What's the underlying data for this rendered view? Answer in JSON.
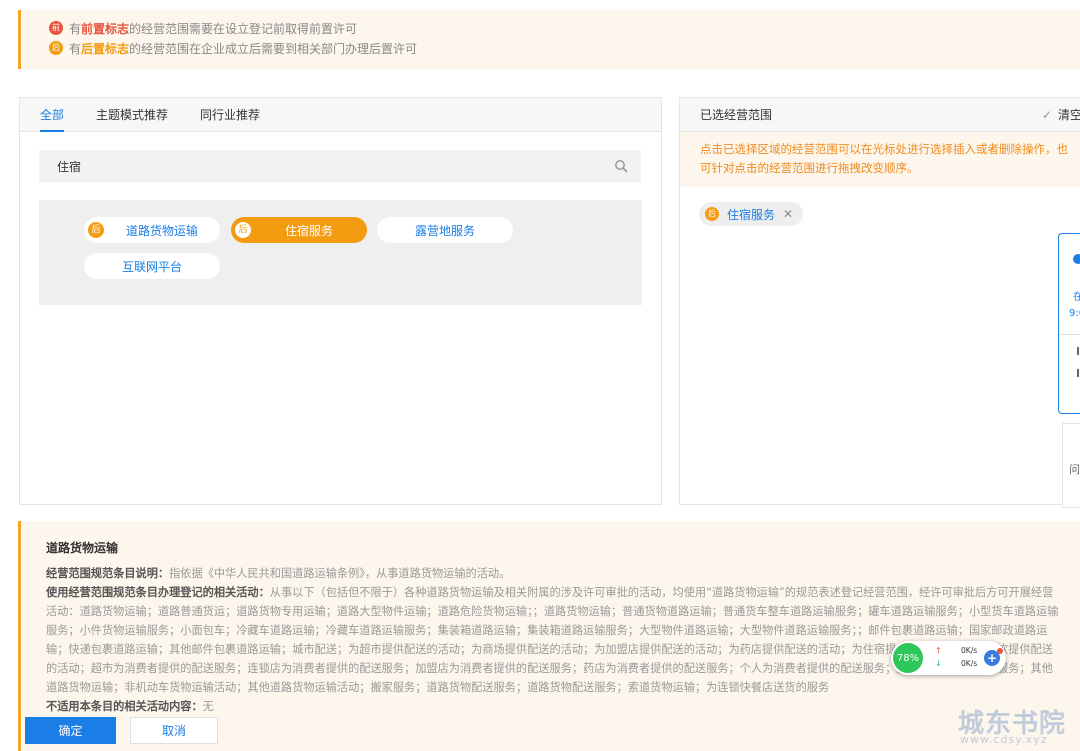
{
  "notice": {
    "pre_badge": "前",
    "pre_text_1": "有",
    "pre_mark": "前置标志",
    "pre_text_2": "的经营范围需要在设立登记前取得前置许可",
    "post_badge": "后",
    "post_text_1": "有",
    "post_mark": "后置标志",
    "post_text_2": "的经营范围在企业成立后需要到相关部门办理后置许可"
  },
  "left_panel": {
    "tabs": [
      {
        "label": "全部",
        "active": true
      },
      {
        "label": "主题模式推荐",
        "active": false
      },
      {
        "label": "同行业推荐",
        "active": false
      }
    ],
    "search": {
      "value": "住宿",
      "icon": "search-icon"
    },
    "chips": [
      {
        "label": "道路货物运输",
        "badge": "后",
        "selected": false
      },
      {
        "label": "住宿服务",
        "badge": "后",
        "selected": true
      },
      {
        "label": "露营地服务",
        "badge": "",
        "selected": false
      },
      {
        "label": "互联网平台",
        "badge": "",
        "selected": false
      }
    ]
  },
  "right_panel": {
    "title": "已选经营范围",
    "clear_label": "清空",
    "tip": "点击已选择区域的经营范围可以在光标处进行选择插入或者删除操作，也可针对点击的经营范围进行拖拽改变顺序。",
    "selected": [
      {
        "label": "住宿服务",
        "badge": "后"
      }
    ]
  },
  "side_widget": {
    "text_1": "在",
    "text_2": "9:0",
    "q_text": "问"
  },
  "description": {
    "title": "道路货物运输",
    "note_label": "经营范围规范条目说明：",
    "note_text": "指依据《中华人民共和国道路运输条例》，从事道路货物运输的活动。",
    "activity_label": "使用经营范围规范条目办理登记的相关活动：",
    "activity_text": "从事以下（包括但不限于）各种道路货物运输及相关附属的涉及许可审批的活动，均使用“道路货物运输”的规范表述登记经营范围，经许可审批后方可开展经营活动：道路货物运输；道路普通货运；道路货物专用运输；道路大型物件运输；道路危险货物运输；；道路货物运输；普通货物道路运输；普通货车整车道路运输服务；罐车道路运输服务；小型货车道路运输服务；小件货物运输服务；小面包车；冷藏车道路运输；冷藏车道路运输服务；集装箱道路运输；集装箱道路运输服务；大型物件道路运输；大型物件道路运输服务；；邮件包裹道路运输；国家邮政道路运输；快递包裹道路运输；其他邮件包裹道路运输；城市配送；为超市提供配送的活动；为商场提供配送的活动；为加盟店提供配送的活动；为药店提供配送的活动；为住宿提供配送的活动；为餐饮提供配送的活动；超市为消费者提供的配送服务；连锁店为消费者提供的配送服务；加盟店为消费者提供的配送服务；药店为消费者提供的配送服务；个人为消费者提供的配送服务；搬家运输；搬家运输服务；其他道路货物运输；非机动车货物运输活动；其他道路货物运输活动；搬家服务；道路货物配送服务；道路货物配送服务；索道货物运输；为连锁快餐店送货的服务",
    "excluded_label": "不适用本条目的相关活动内容：",
    "excluded_text": "无"
  },
  "buttons": {
    "ok": "确定",
    "cancel": "取消"
  },
  "speed_widget": {
    "percent": "78%",
    "up": "0K/s",
    "down": "0K/s"
  },
  "watermark": {
    "title": "城东书院",
    "url": "www.cdsy.xyz"
  },
  "colors": {
    "accent": "#1a7ee6",
    "orange": "#f39c12",
    "red": "#e8553f",
    "notice_bg": "#fdf6ec"
  }
}
